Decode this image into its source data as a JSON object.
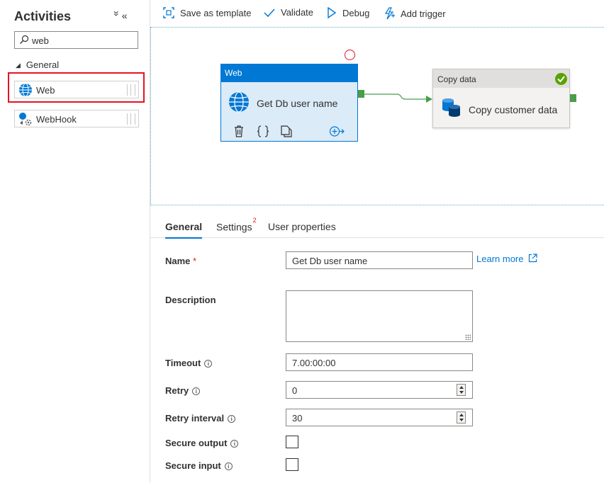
{
  "sidebar": {
    "title": "Activities",
    "collapse_all_glyph": "»",
    "hide_glyph": "«",
    "search": {
      "value": "web",
      "icon": "search-icon"
    },
    "group": "General",
    "items": [
      {
        "label": "Web",
        "icon": "globe-icon"
      },
      {
        "label": "WebHook",
        "icon": "webhook-icon"
      }
    ]
  },
  "toolbar": {
    "save_template": "Save as template",
    "validate": "Validate",
    "debug": "Debug",
    "add_trigger": "Add trigger"
  },
  "canvas": {
    "web_node": {
      "type_label": "Web",
      "name": "Get Db user name"
    },
    "copy_node": {
      "type_label": "Copy data",
      "name": "Copy customer data",
      "status": "succeeded"
    }
  },
  "properties": {
    "tabs": [
      {
        "label": "General",
        "active": true
      },
      {
        "label": "Settings",
        "badge": "2"
      },
      {
        "label": "User properties"
      }
    ],
    "name_label": "Name",
    "required_mark": "*",
    "name_value": "Get Db user name",
    "learn_more": "Learn more",
    "description_label": "Description",
    "description_value": "",
    "timeout_label": "Timeout",
    "timeout_value": "7.00:00:00",
    "retry_label": "Retry",
    "retry_value": "0",
    "retry_interval_label": "Retry interval",
    "retry_interval_value": "30",
    "secure_output_label": "Secure output",
    "secure_input_label": "Secure input",
    "info_glyph": "i"
  },
  "colors": {
    "accent": "#0078d4",
    "success": "#57a300",
    "error": "#e81123",
    "connector": "#4a9d4a"
  }
}
